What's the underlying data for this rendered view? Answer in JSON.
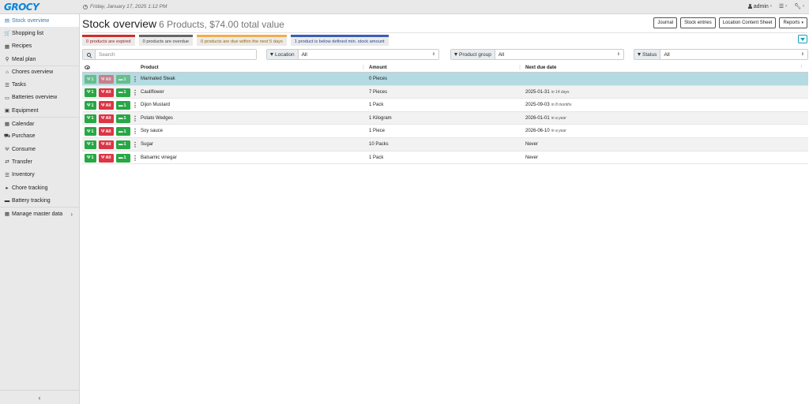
{
  "app": {
    "logo": "GROCY",
    "datetime": "Friday, January 17, 2025 1:12 PM",
    "user": "admin"
  },
  "sidebar": {
    "items": [
      {
        "label": "Stock overview",
        "icon": "box-icon",
        "glyph": "▤",
        "active": true
      },
      {
        "label": "Shopping list",
        "icon": "cart-icon",
        "glyph": "🛒"
      },
      {
        "label": "Recipes",
        "icon": "book-icon",
        "glyph": "▦"
      },
      {
        "label": "Meal plan",
        "icon": "utensils-icon",
        "glyph": "⚲"
      },
      {
        "label": "Chores overview",
        "icon": "home-icon",
        "glyph": "⌂"
      },
      {
        "label": "Tasks",
        "icon": "tasks-icon",
        "glyph": "☰"
      },
      {
        "label": "Batteries overview",
        "icon": "battery-icon",
        "glyph": "▭"
      },
      {
        "label": "Equipment",
        "icon": "equipment-icon",
        "glyph": "▣"
      },
      {
        "label": "Calendar",
        "icon": "calendar-icon",
        "glyph": "▦"
      },
      {
        "label": "Purchase",
        "icon": "purchase-cart-icon",
        "glyph": "⛟"
      },
      {
        "label": "Consume",
        "icon": "consume-icon",
        "glyph": "Ψ"
      },
      {
        "label": "Transfer",
        "icon": "transfer-icon",
        "glyph": "⇄"
      },
      {
        "label": "Inventory",
        "icon": "inventory-icon",
        "glyph": "☰"
      },
      {
        "label": "Chore tracking",
        "icon": "play-icon",
        "glyph": "▸"
      },
      {
        "label": "Battery tracking",
        "icon": "battery-track-icon",
        "glyph": "▬"
      },
      {
        "label": "Manage master data",
        "icon": "table-icon",
        "glyph": "▦"
      }
    ],
    "collapse": "‹"
  },
  "header": {
    "title": "Stock overview",
    "subtitle": "6 Products, $74.00 total value",
    "buttons": [
      "Journal",
      "Stock entries",
      "Location Content Sheet",
      "Reports"
    ]
  },
  "status": {
    "expired": "0 products are expired",
    "overdue": "0 products are overdue",
    "due": "0 products are due within the next 5 days",
    "below": "1 product is below defined min. stock amount"
  },
  "filters": {
    "search_placeholder": "Search",
    "location_label": "Location",
    "location_value": "All",
    "product_group_label": "Product group",
    "product_group_value": "All",
    "status_label": "Status",
    "status_value": "All"
  },
  "table": {
    "columns": {
      "product": "Product",
      "amount": "Amount",
      "due": "Next due date"
    },
    "action_labels": {
      "consume_one": "1",
      "consume_all": "All",
      "open_one": "1"
    },
    "rows": [
      {
        "product": "Marinated Steak",
        "amount": "0 Pieces",
        "due": "",
        "relative": "",
        "highlight": true
      },
      {
        "product": "Cauliflower",
        "amount": "7 Pieces",
        "due": "2025-01-31",
        "relative": "in 14 days"
      },
      {
        "product": "Dijon Mustard",
        "amount": "1 Pack",
        "due": "2025-09-03",
        "relative": "in 8 months"
      },
      {
        "product": "Potato Wedges",
        "amount": "1 Kilogram",
        "due": "2026-01-01",
        "relative": "in a year"
      },
      {
        "product": "Soy sauce",
        "amount": "1 Piece",
        "due": "2026-06-10",
        "relative": "in a year"
      },
      {
        "product": "Sugar",
        "amount": "10 Packs",
        "due": "Never",
        "relative": ""
      },
      {
        "product": "Balsamic vinegar",
        "amount": "1 Pack",
        "due": "Never",
        "relative": ""
      }
    ]
  }
}
